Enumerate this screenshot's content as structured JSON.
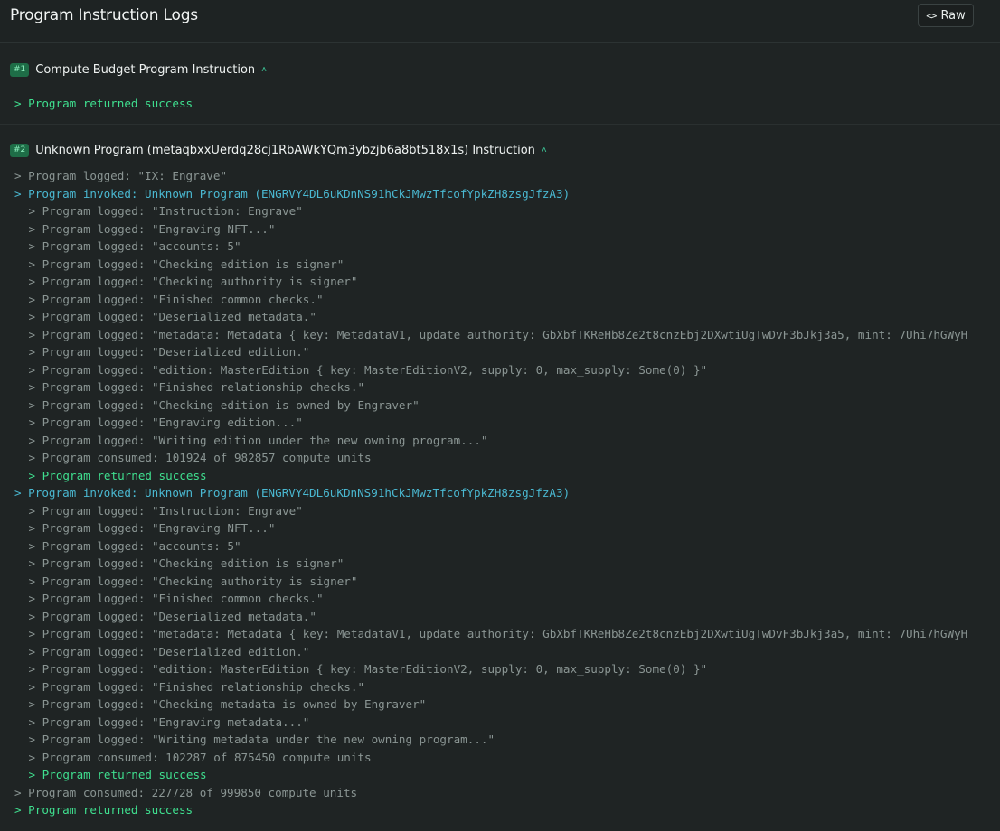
{
  "header": {
    "title": "Program Instruction Logs",
    "raw_button_label": "Raw",
    "raw_icon": "code-icon"
  },
  "instructions": [
    {
      "badge": "#1",
      "title": "Compute Budget Program Instruction",
      "logs": [
        {
          "indent": 0,
          "type": "success",
          "text": "> Program returned success"
        }
      ]
    },
    {
      "badge": "#2",
      "title": "Unknown Program (metaqbxxUerdq28cj1RbAWkYQm3ybzjb6a8bt518x1s) Instruction",
      "logs": [
        {
          "indent": 0,
          "type": "plain",
          "text": "> Program logged: \"IX: Engrave\""
        },
        {
          "indent": 0,
          "type": "invoke",
          "text": "> Program invoked: Unknown Program (ENGRVY4DL6uKDnNS91hCkJMwzTfcofYpkZH8zsgJfzA3)"
        },
        {
          "indent": 1,
          "type": "plain",
          "text": "> Program logged: \"Instruction: Engrave\""
        },
        {
          "indent": 1,
          "type": "plain",
          "text": "> Program logged: \"Engraving NFT...\""
        },
        {
          "indent": 1,
          "type": "plain",
          "text": "> Program logged: \"accounts: 5\""
        },
        {
          "indent": 1,
          "type": "plain",
          "text": "> Program logged: \"Checking edition is signer\""
        },
        {
          "indent": 1,
          "type": "plain",
          "text": "> Program logged: \"Checking authority is signer\""
        },
        {
          "indent": 1,
          "type": "plain",
          "text": "> Program logged: \"Finished common checks.\""
        },
        {
          "indent": 1,
          "type": "plain",
          "text": "> Program logged: \"Deserialized metadata.\""
        },
        {
          "indent": 1,
          "type": "plain",
          "text": "> Program logged: \"metadata: Metadata { key: MetadataV1, update_authority: GbXbfTKReHb8Ze2t8cnzEbj2DXwtiUgTwDvF3bJkj3a5, mint: 7Uhi7hGWyH"
        },
        {
          "indent": 1,
          "type": "plain",
          "text": "> Program logged: \"Deserialized edition.\""
        },
        {
          "indent": 1,
          "type": "plain",
          "text": "> Program logged: \"edition: MasterEdition { key: MasterEditionV2, supply: 0, max_supply: Some(0) }\""
        },
        {
          "indent": 1,
          "type": "plain",
          "text": "> Program logged: \"Finished relationship checks.\""
        },
        {
          "indent": 1,
          "type": "plain",
          "text": "> Program logged: \"Checking edition is owned by Engraver\""
        },
        {
          "indent": 1,
          "type": "plain",
          "text": "> Program logged: \"Engraving edition...\""
        },
        {
          "indent": 1,
          "type": "plain",
          "text": "> Program logged: \"Writing edition under the new owning program...\""
        },
        {
          "indent": 1,
          "type": "plain",
          "text": "> Program consumed: 101924 of 982857 compute units"
        },
        {
          "indent": 1,
          "type": "success",
          "text": "> Program returned success"
        },
        {
          "indent": 0,
          "type": "invoke",
          "text": "> Program invoked: Unknown Program (ENGRVY4DL6uKDnNS91hCkJMwzTfcofYpkZH8zsgJfzA3)"
        },
        {
          "indent": 1,
          "type": "plain",
          "text": "> Program logged: \"Instruction: Engrave\""
        },
        {
          "indent": 1,
          "type": "plain",
          "text": "> Program logged: \"Engraving NFT...\""
        },
        {
          "indent": 1,
          "type": "plain",
          "text": "> Program logged: \"accounts: 5\""
        },
        {
          "indent": 1,
          "type": "plain",
          "text": "> Program logged: \"Checking edition is signer\""
        },
        {
          "indent": 1,
          "type": "plain",
          "text": "> Program logged: \"Checking authority is signer\""
        },
        {
          "indent": 1,
          "type": "plain",
          "text": "> Program logged: \"Finished common checks.\""
        },
        {
          "indent": 1,
          "type": "plain",
          "text": "> Program logged: \"Deserialized metadata.\""
        },
        {
          "indent": 1,
          "type": "plain",
          "text": "> Program logged: \"metadata: Metadata { key: MetadataV1, update_authority: GbXbfTKReHb8Ze2t8cnzEbj2DXwtiUgTwDvF3bJkj3a5, mint: 7Uhi7hGWyH"
        },
        {
          "indent": 1,
          "type": "plain",
          "text": "> Program logged: \"Deserialized edition.\""
        },
        {
          "indent": 1,
          "type": "plain",
          "text": "> Program logged: \"edition: MasterEdition { key: MasterEditionV2, supply: 0, max_supply: Some(0) }\""
        },
        {
          "indent": 1,
          "type": "plain",
          "text": "> Program logged: \"Finished relationship checks.\""
        },
        {
          "indent": 1,
          "type": "plain",
          "text": "> Program logged: \"Checking metadata is owned by Engraver\""
        },
        {
          "indent": 1,
          "type": "plain",
          "text": "> Program logged: \"Engraving metadata...\""
        },
        {
          "indent": 1,
          "type": "plain",
          "text": "> Program logged: \"Writing metadata under the new owning program...\""
        },
        {
          "indent": 1,
          "type": "plain",
          "text": "> Program consumed: 102287 of 875450 compute units"
        },
        {
          "indent": 1,
          "type": "success",
          "text": "> Program returned success"
        },
        {
          "indent": 0,
          "type": "plain",
          "text": "> Program consumed: 227728 of 999850 compute units"
        },
        {
          "indent": 0,
          "type": "success",
          "text": "> Program returned success"
        }
      ]
    }
  ],
  "colors": {
    "background": "#1f2424",
    "badge_bg": "#1e6d47",
    "badge_text": "#8ef0bf",
    "log_plain": "#8a9593",
    "log_invoke": "#4ab8d1",
    "log_success": "#3fdf8f",
    "collapse_icon": "#3fd3a1"
  }
}
